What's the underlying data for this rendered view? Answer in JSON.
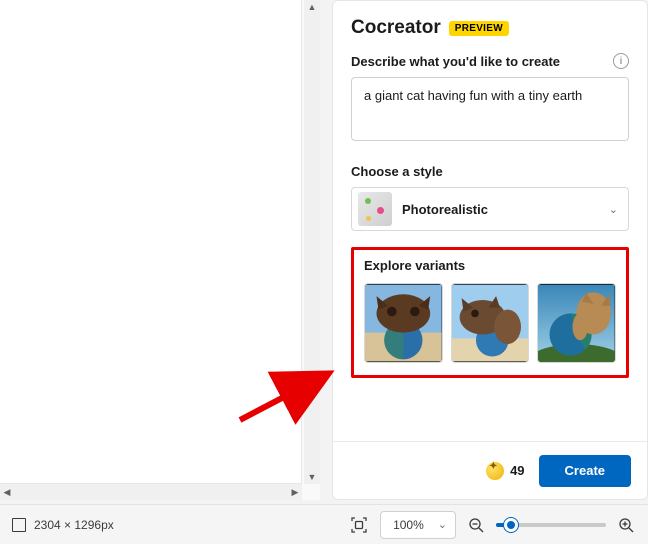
{
  "panel": {
    "title": "Cocreator",
    "badge": "PREVIEW",
    "describe_label": "Describe what you'd like to create",
    "prompt_value": "a giant cat having fun with a tiny earth",
    "style_label": "Choose a style",
    "style_selected": "Photorealistic",
    "variants_label": "Explore variants",
    "credits": "49",
    "create_label": "Create"
  },
  "statusbar": {
    "canvas_size": "2304 × 1296px",
    "zoom_value": "100%"
  }
}
